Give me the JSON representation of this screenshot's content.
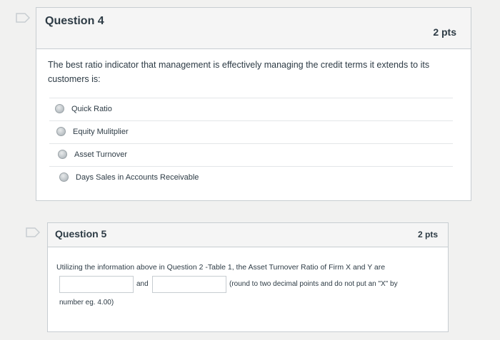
{
  "questions": [
    {
      "title": "Question 4",
      "points": "2 pts",
      "text": "The best ratio indicator that management is effectively managing the credit terms it extends to its customers is:",
      "answers": [
        "Quick Ratio",
        "Equity Mulitplier",
        "Asset Turnover",
        "Days Sales in Accounts Receivable"
      ]
    },
    {
      "title": "Question 5",
      "points": "2 pts",
      "text": "Utilizing the information above in Question 2 -Table 1, the Asset Turnover Ratio of Firm X and Y are",
      "and_label": "and",
      "rounding_note": "(round to two decimal points and do not put an \"X\" by",
      "tail_note": "number eg. 4.00)",
      "inputs": [
        "",
        ""
      ]
    }
  ],
  "colors": {
    "flag": "#c7cdd1",
    "border": "#c7cdd1",
    "header_bg": "#f5f5f5"
  }
}
